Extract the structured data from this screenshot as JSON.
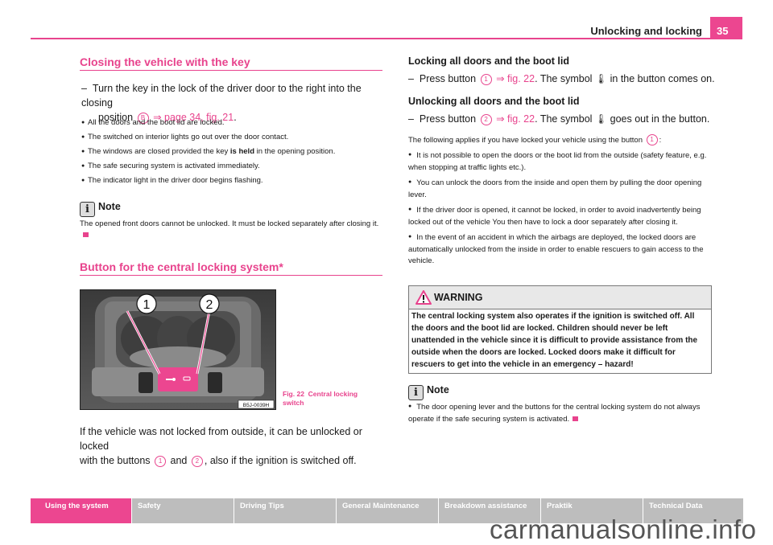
{
  "header": {
    "title": "Unlocking and locking",
    "page_number": "35"
  },
  "left": {
    "section1": {
      "heading": "Closing the vehicle with the key",
      "step_prefix": "–",
      "step_text_1": "Turn the key in the lock of the driver door to the right into the closing",
      "step_text_2": "position",
      "step_badge": "B",
      "step_arrow": "⇒",
      "step_link": "page 34, fig. 21",
      "step_end": ".",
      "bullets": [
        {
          "before": "All the doors and the boot lid are locked.",
          "bold": "",
          "after": ""
        },
        {
          "before": "The switched on interior lights go out over the door contact.",
          "bold": "",
          "after": ""
        },
        {
          "before": "The windows are closed provided the key ",
          "bold": "is held",
          "after": " in the opening position."
        },
        {
          "before": "The safe securing system is activated immediately.",
          "bold": "",
          "after": ""
        },
        {
          "before": "The indicator light in the driver door begins flashing.",
          "bold": "",
          "after": ""
        }
      ],
      "note": {
        "title": "Note",
        "text": "The opened front doors cannot be unlocked. It must be locked separately after closing it."
      }
    },
    "section2": {
      "heading": "Button for the central locking system*",
      "figure": {
        "callouts": [
          "1",
          "2"
        ],
        "code": "B5J-0039H",
        "caption_num": "Fig. 22",
        "caption_text": "Central locking switch"
      },
      "para_1": "If the vehicle was not locked from outside, it can be unlocked or locked",
      "para_2a": "with the buttons",
      "para_badge1": "1",
      "para_and": "and",
      "para_badge2": "2",
      "para_2b": ", also if the ignition is switched off."
    }
  },
  "right": {
    "lock": {
      "heading": "Locking all doors and the boot lid",
      "step_a": "Press button",
      "badge": "1",
      "arrow": "⇒",
      "link": "fig. 22",
      "step_b": ". The symbol",
      "step_c": "in the button comes on."
    },
    "unlock": {
      "heading": "Unlocking all doors and the boot lid",
      "step_a": "Press button",
      "badge": "2",
      "arrow": "⇒",
      "link": "fig. 22",
      "step_b": ". The symbol",
      "step_c": "goes out in the button."
    },
    "applies_a": "The following applies if you have locked your vehicle using the button",
    "applies_badge": "1",
    "applies_b": ":",
    "bullets": [
      "It is not possible to open the doors or the boot lid from the outside (safety feature, e.g. when stopping at traffic lights etc.).",
      "You can unlock the doors from the inside and open them by pulling the door opening lever.",
      "If the driver door is opened, it cannot be locked, in order to avoid inadvertently being locked out of the vehicle You then have to lock a door separately after closing it.",
      "In the event of an accident in which the airbags are deployed, the locked doors are automatically unlocked from the inside in order to enable rescuers to gain access to the vehicle."
    ],
    "warning": {
      "title": "WARNING",
      "text": "The central locking system also operates if the ignition is switched off. All the doors and the boot lid are locked. Children should never be left unattended in the vehicle since it is difficult to provide assistance from the outside when the doors are locked. Locked doors make it difficult for rescuers to get into the vehicle in an emergency – hazard!"
    },
    "note": {
      "title": "Note",
      "text": "The door opening lever and the buttons for the central locking system do not always operate if the safe securing system is activated."
    }
  },
  "footer": {
    "tabs": [
      {
        "label": "Using the system",
        "active": true
      },
      {
        "label": "Safety"
      },
      {
        "label": "Driving Tips"
      },
      {
        "label": "General Maintenance"
      },
      {
        "label": "Breakdown assistance"
      },
      {
        "label": "Praktik"
      },
      {
        "label": "Technical Data"
      }
    ],
    "watermark": "carmanualsonline.info"
  },
  "colors": {
    "accent": "#e8438d",
    "tab_inactive": "#bdbdbd"
  }
}
